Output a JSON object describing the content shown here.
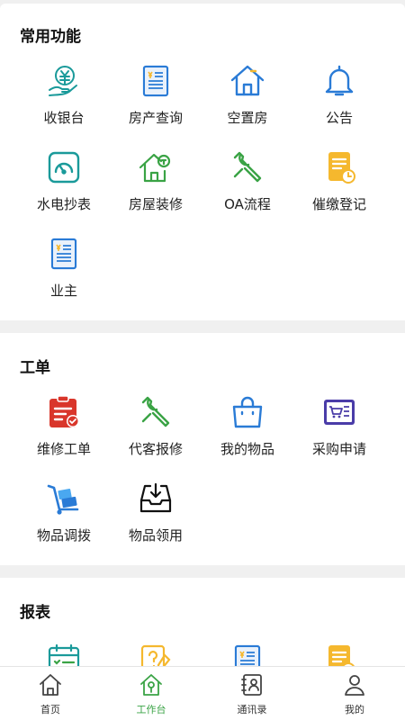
{
  "sections": {
    "common": {
      "title": "常用功能",
      "items": [
        {
          "label": "收银台",
          "icon": "cashier-icon"
        },
        {
          "label": "房产查询",
          "icon": "property-query-icon"
        },
        {
          "label": "空置房",
          "icon": "vacant-house-icon"
        },
        {
          "label": "公告",
          "icon": "bell-icon"
        },
        {
          "label": "水电抄表",
          "icon": "meter-icon"
        },
        {
          "label": "房屋装修",
          "icon": "house-decoration-icon"
        },
        {
          "label": "OA流程",
          "icon": "wrench-icon"
        },
        {
          "label": "催缴登记",
          "icon": "payment-reminder-icon"
        },
        {
          "label": "业主",
          "icon": "owner-icon"
        }
      ]
    },
    "workorder": {
      "title": "工单",
      "items": [
        {
          "label": "维修工单",
          "icon": "repair-order-icon"
        },
        {
          "label": "代客报修",
          "icon": "wrench-icon"
        },
        {
          "label": "我的物品",
          "icon": "bag-icon"
        },
        {
          "label": "采购申请",
          "icon": "purchase-icon"
        },
        {
          "label": "物品调拨",
          "icon": "trolley-icon"
        },
        {
          "label": "物品领用",
          "icon": "inbox-icon"
        }
      ]
    },
    "reports": {
      "title": "报表"
    }
  },
  "tabbar": {
    "items": [
      {
        "label": "首页",
        "icon": "home-icon"
      },
      {
        "label": "工作台",
        "icon": "workbench-icon"
      },
      {
        "label": "通讯录",
        "icon": "contacts-icon"
      },
      {
        "label": "我的",
        "icon": "user-icon"
      }
    ],
    "active_index": 1
  },
  "colors": {
    "teal": "#1a9a9a",
    "blue": "#2a7bd6",
    "green": "#3aa345",
    "yellow": "#f5b82e",
    "red": "#d9362b",
    "purple": "#4a3ca8",
    "active_tab": "#3aa345"
  }
}
